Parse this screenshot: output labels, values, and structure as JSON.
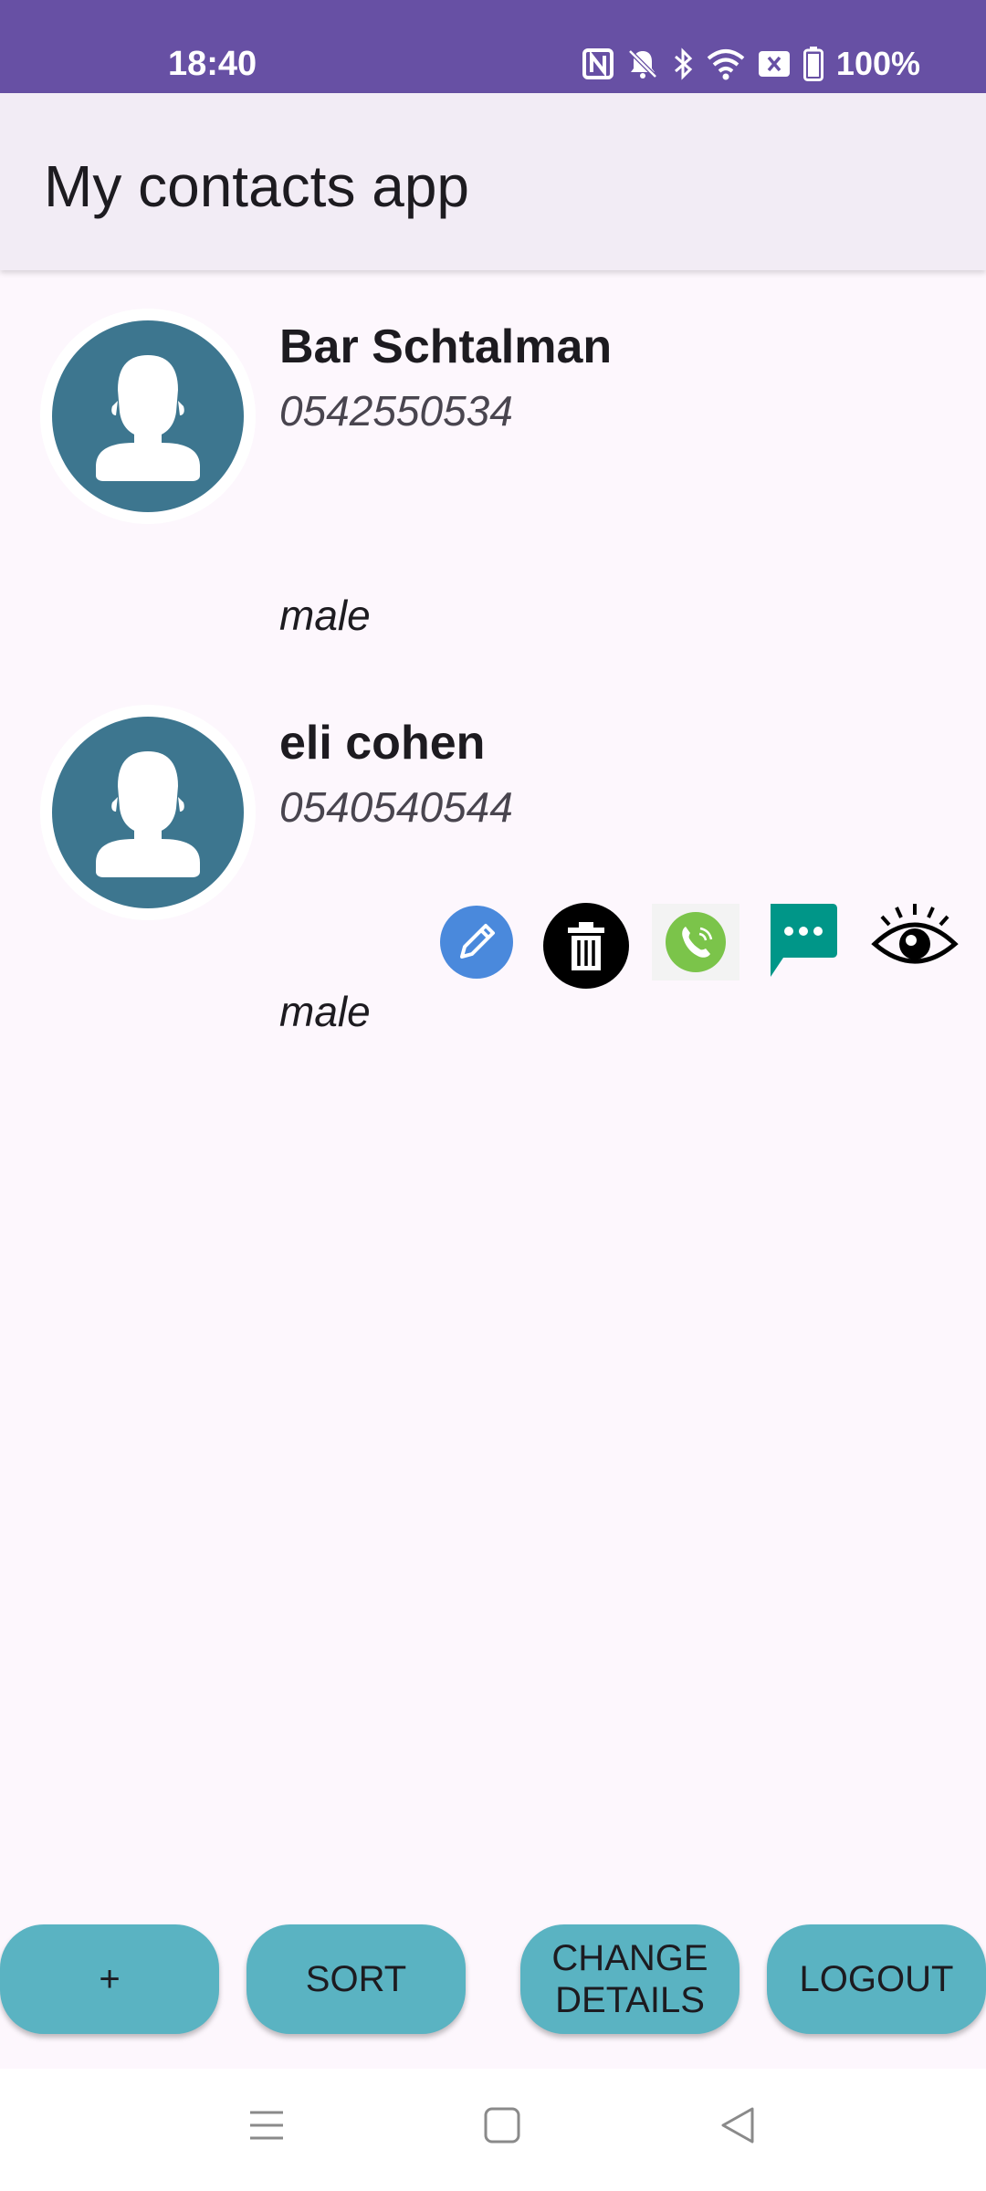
{
  "status_bar": {
    "time": "18:40",
    "battery": "100%",
    "icons": [
      "nfc-icon",
      "bell-off-icon",
      "bluetooth-icon",
      "wifi-icon",
      "sim-x-icon",
      "battery-icon"
    ],
    "bg_color": "#6750a4"
  },
  "app_bar": {
    "title": "My contacts app"
  },
  "contacts": [
    {
      "name": "Bar Schtalman",
      "phone": "0542550534",
      "gender": "male",
      "avatar_icon": "person-avatar-icon",
      "actions_visible": false
    },
    {
      "name": "eli cohen",
      "phone": "0540540544",
      "gender": "male",
      "avatar_icon": "person-avatar-icon",
      "actions_visible": true,
      "actions": [
        "edit-icon",
        "delete-icon",
        "phone-call-icon",
        "message-icon",
        "view-icon"
      ]
    }
  ],
  "bottom_buttons": {
    "add": "+",
    "sort": "SORT",
    "change_details_line1": "CHANGE",
    "change_details_line2": "DETAILS",
    "logout": "LOGOUT"
  },
  "nav_bar": {
    "icons": [
      "menu-icon",
      "home-icon",
      "back-icon"
    ]
  },
  "colors": {
    "accent_teal": "#5ab3c2",
    "avatar_bg": "#3d768f",
    "edit_blue": "#4a89dc",
    "call_green": "#7bc44a",
    "message_teal": "#009688"
  }
}
